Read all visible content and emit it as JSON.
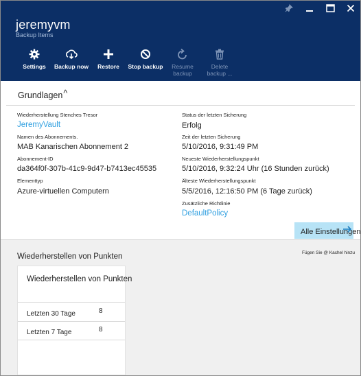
{
  "header": {
    "title": "jeremyvm",
    "subtitle": "Backup Items"
  },
  "window_controls": [
    "pin-icon",
    "minimize-icon",
    "maximize-icon",
    "close-icon"
  ],
  "toolbar": {
    "settings": "Settings",
    "backup_now": "Backup now",
    "restore": "Restore",
    "stop_backup": "Stop backup",
    "resume_backup": "Resume backup",
    "delete_backup": "Delete backup ..."
  },
  "essentials": {
    "heading": "Grundlagen",
    "caret": "^",
    "left": {
      "vault_label": "Wiederherstellung Stenches Tresor",
      "vault_value": "JeremyVault",
      "sub_name_label": "Namen des Abonnements.",
      "sub_name_value": "MAB Kanarischen Abonnement 2",
      "sub_id_label": "Abonnement-ID",
      "sub_id_value": "da364f0f-307b-41c9-9d47-b7413ec45535",
      "item_type_label": "Elementtyp",
      "item_type_value": "Azure-virtuellen Computern"
    },
    "right": {
      "last_status_label": "Status der letzten Sicherung",
      "last_status_value": "Erfolg",
      "last_time_label": "Zeit der letzten Sicherung",
      "last_time_value": "5/10/2016, 9:31:49 PM",
      "newest_label": "Neueste Wiederherstellungspunkt",
      "newest_value": "5/10/2016, 9:32:24 Uhr (16 Stunden zurück)",
      "oldest_label": "Älteste Wiederherstellungspunkt",
      "oldest_value": "5/5/2016, 12:16:50 PM (6 Tage zurück)",
      "policy_label": "Zusätzliche Richtlinie",
      "policy_value": "DefaultPolicy"
    },
    "all_settings": "Alle Einstellungen"
  },
  "restore_points": {
    "section_title": "Wiederherstellen von Punkten",
    "pin_hint": "Fügen Sie @ Kachel hinzu",
    "tile_title": "Wiederherstellen von Punkten",
    "rows": [
      {
        "label": "Letzten 30 Tage",
        "value": "8"
      },
      {
        "label": "Letzten 7 Tage",
        "value": "8"
      }
    ]
  },
  "colors": {
    "header_bg": "#0c2f66",
    "link": "#2f9fe0",
    "all_settings_bg": "#b7e3f6"
  }
}
